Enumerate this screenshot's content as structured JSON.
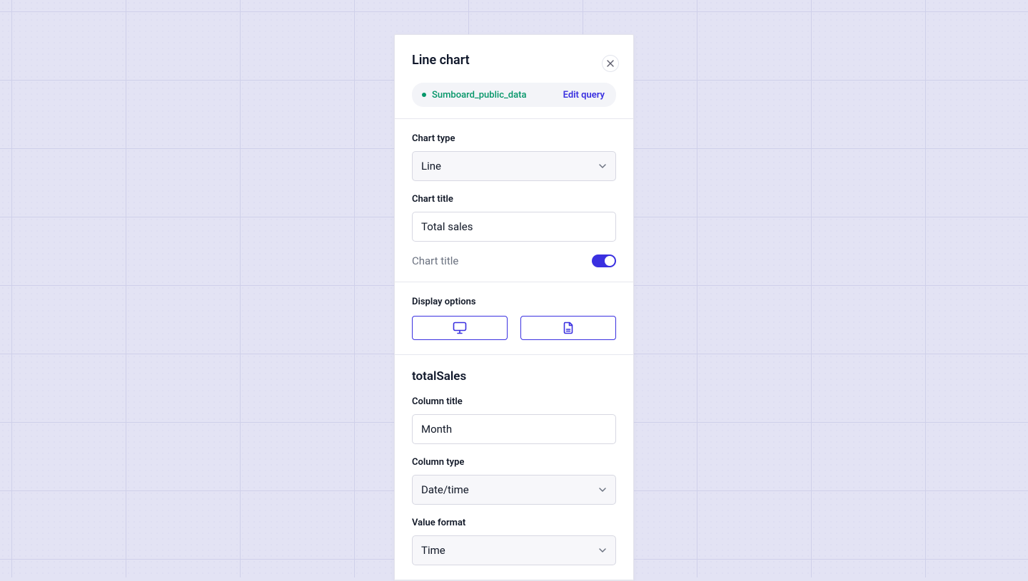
{
  "panel": {
    "title": "Line chart",
    "datasource": {
      "name": "Sumboard_public_data",
      "edit_label": "Edit query"
    },
    "chart_type": {
      "label": "Chart type",
      "value": "Line"
    },
    "chart_title": {
      "label": "Chart title",
      "value": "Total sales",
      "toggle_label": "Chart title",
      "toggle_on": true
    },
    "display_options": {
      "label": "Display options"
    },
    "column": {
      "name": "totalSales",
      "column_title": {
        "label": "Column title",
        "value": "Month"
      },
      "column_type": {
        "label": "Column type",
        "value": "Date/time"
      },
      "value_format": {
        "label": "Value format",
        "value": "Time"
      }
    }
  },
  "colors": {
    "accent": "#3A30E0",
    "success": "#059669"
  }
}
